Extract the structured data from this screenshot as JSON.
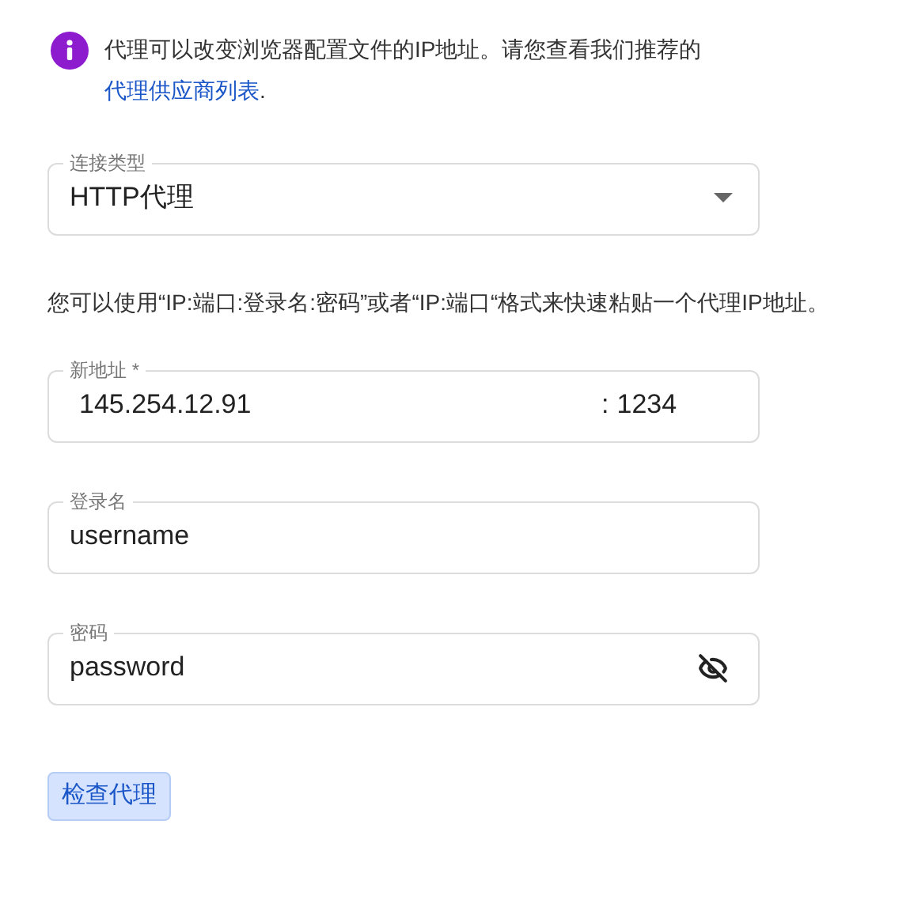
{
  "info": {
    "text": "代理可以改变浏览器配置文件的IP地址。请您查看我们推荐的",
    "link": "代理供应商列表",
    "suffix": "."
  },
  "connection_type": {
    "label": "连接类型",
    "value": "HTTP代理"
  },
  "hint": "您可以使用“IP:端口:登录名:密码”或者“IP:端口“格式来快速粘贴一个代理IP地址。",
  "address": {
    "label": "新地址 *",
    "ip": "145.254.12.91",
    "separator": ":",
    "port": "1234"
  },
  "login": {
    "label": "登录名",
    "value": "username"
  },
  "password": {
    "label": "密码",
    "value": "password"
  },
  "check_button": "检查代理"
}
